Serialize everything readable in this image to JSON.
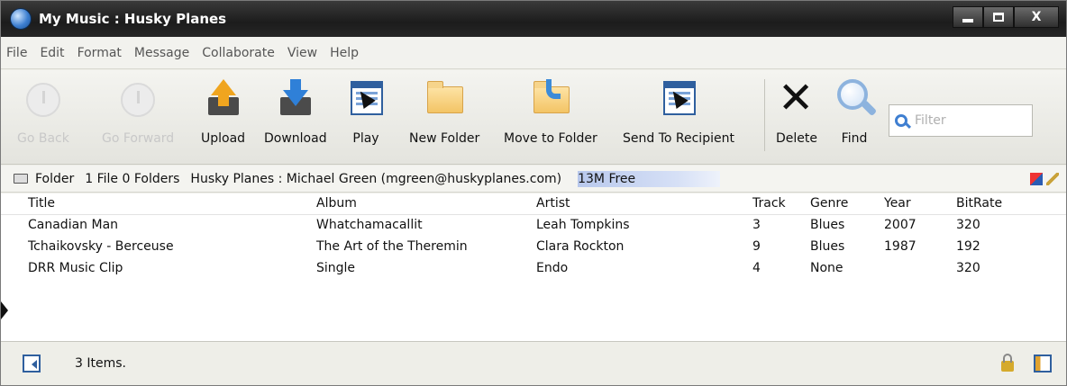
{
  "window": {
    "title": "My Music : Husky Planes",
    "controls": {
      "close": "X"
    }
  },
  "menu": [
    "File",
    "Edit",
    "Format",
    "Message",
    "Collaborate",
    "View",
    "Help"
  ],
  "toolbar": {
    "go_back": "Go Back",
    "go_forward": "Go Forward",
    "upload": "Upload",
    "download": "Download",
    "play": "Play",
    "new_folder": "New Folder",
    "move_to_folder": "Move to Folder",
    "send_to_recipient": "Send To Recipient",
    "delete": "Delete",
    "find": "Find",
    "filter_placeholder": "Filter"
  },
  "folderbar": {
    "folder_label": "Folder",
    "counts": "1 File 0 Folders",
    "owner": "Husky Planes : Michael Green (mgreen@huskyplanes.com)",
    "free_space": "13M Free"
  },
  "table": {
    "columns": {
      "title": "Title",
      "album": "Album",
      "artist": "Artist",
      "track": "Track",
      "genre": "Genre",
      "year": "Year",
      "bitrate": "BitRate"
    },
    "rows": [
      {
        "title": "Canadian Man",
        "album": "Whatchamacallit",
        "artist": "Leah Tompkins",
        "track": "3",
        "genre": "Blues",
        "year": "2007",
        "bitrate": "320"
      },
      {
        "title": "Tchaikovsky - Berceuse",
        "album": "The Art of the Theremin",
        "artist": "Clara Rockton",
        "track": "9",
        "genre": "Blues",
        "year": "1987",
        "bitrate": "192"
      },
      {
        "title": "DRR Music Clip",
        "album": "Single",
        "artist": "Endo",
        "track": "4",
        "genre": "None",
        "year": "",
        "bitrate": "320"
      }
    ]
  },
  "statusbar": {
    "items_text": "3 Items."
  }
}
